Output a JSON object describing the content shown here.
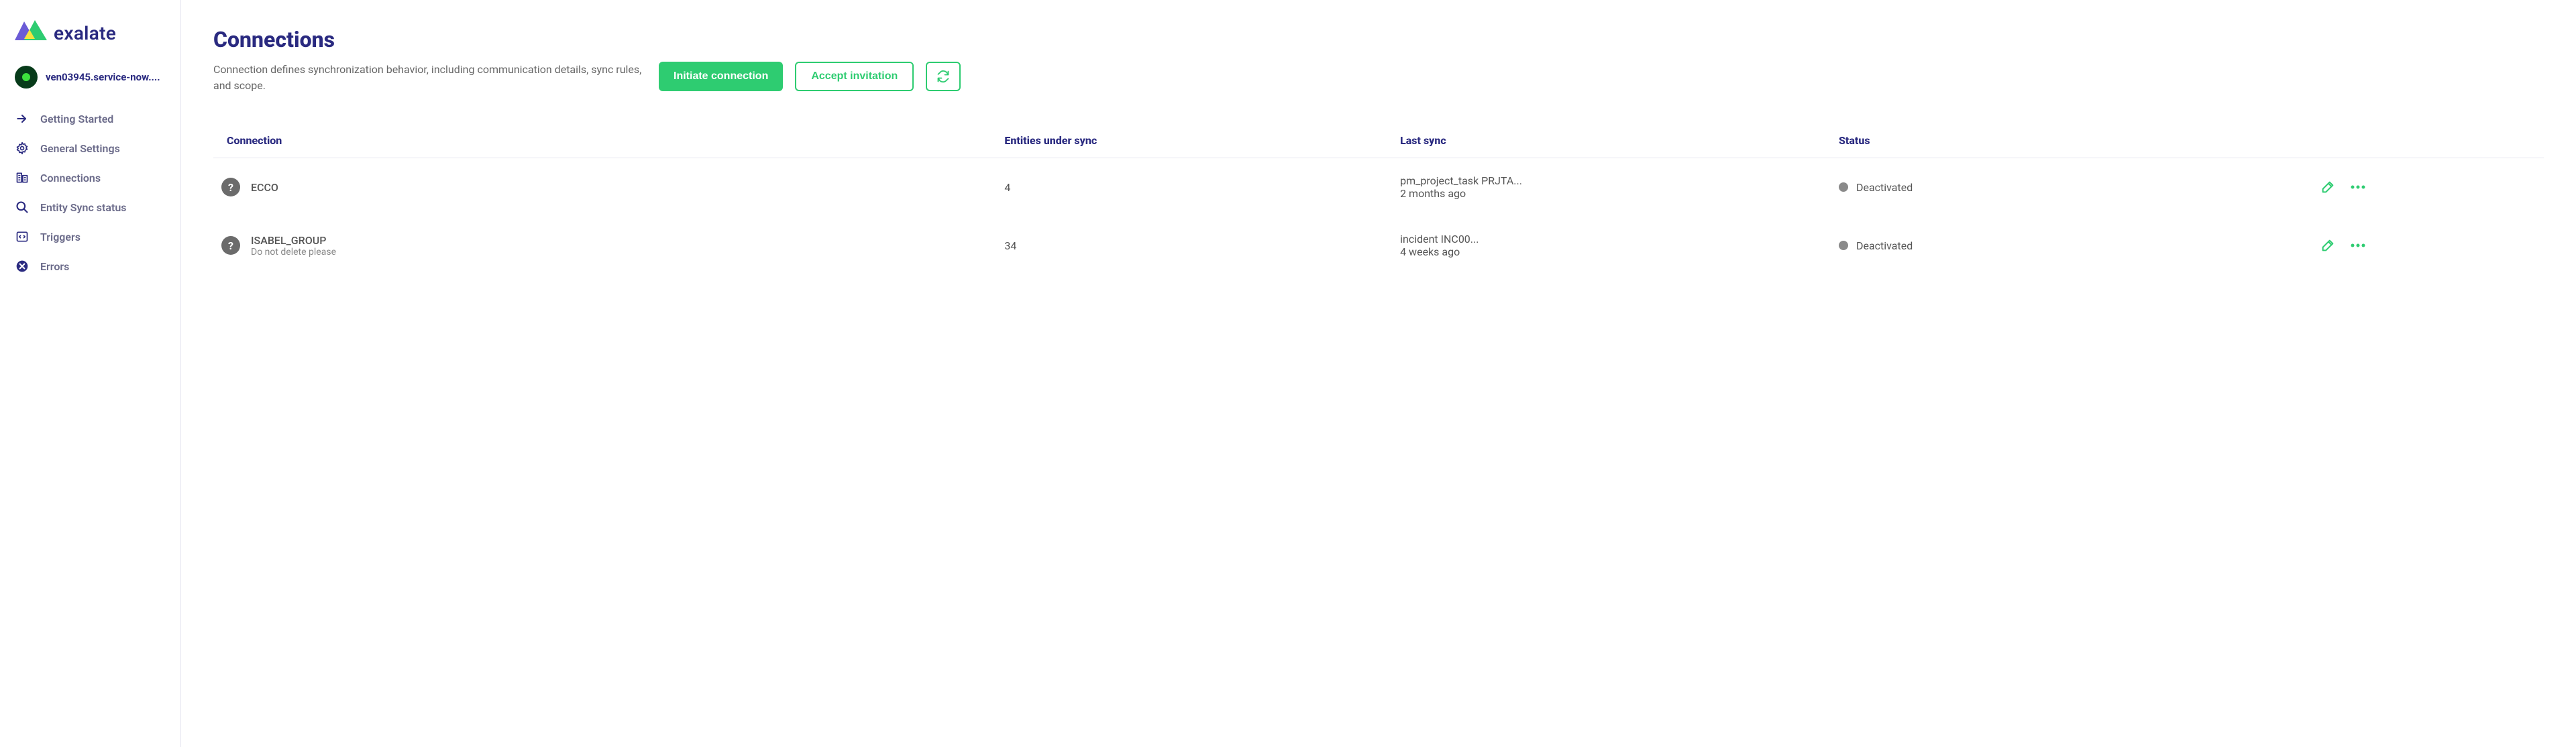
{
  "brand": {
    "name": "exalate"
  },
  "instance": {
    "name": "ven03945.service-now...."
  },
  "sidebar": {
    "items": [
      {
        "label": "Getting Started",
        "icon": "arrow"
      },
      {
        "label": "General Settings",
        "icon": "gear"
      },
      {
        "label": "Connections",
        "icon": "buildings"
      },
      {
        "label": "Entity Sync status",
        "icon": "search"
      },
      {
        "label": "Triggers",
        "icon": "code"
      },
      {
        "label": "Errors",
        "icon": "x-circle"
      }
    ]
  },
  "page": {
    "title": "Connections",
    "description": "Connection defines synchronization behavior, including communication details, sync rules, and scope."
  },
  "actions": {
    "initiate": "Initiate connection",
    "accept": "Accept invitation"
  },
  "table": {
    "headers": {
      "connection": "Connection",
      "entities": "Entities under sync",
      "last_sync": "Last sync",
      "status": "Status"
    },
    "rows": [
      {
        "name": "ECCO",
        "note": "",
        "entities": "4",
        "last_sync_item": "pm_project_task PRJTA...",
        "last_sync_time": "2 months ago",
        "status": "Deactivated"
      },
      {
        "name": "ISABEL_GROUP",
        "note": "Do not delete please",
        "entities": "34",
        "last_sync_item": "incident INC00...",
        "last_sync_time": "4 weeks ago",
        "status": "Deactivated"
      }
    ]
  }
}
